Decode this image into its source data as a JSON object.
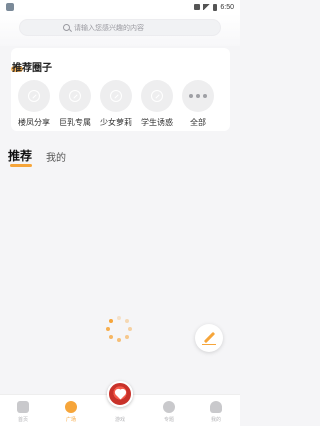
{
  "status_bar": {
    "time": "6:50"
  },
  "search": {
    "placeholder": "请输入您感兴趣的内容"
  },
  "recommended_circles": {
    "title": "推荐圈子",
    "items": [
      {
        "label": "楼凤分享",
        "icon": "image-placeholder-icon"
      },
      {
        "label": "巨乳专属",
        "icon": "image-placeholder-icon"
      },
      {
        "label": "少女萝莉",
        "icon": "image-placeholder-icon"
      },
      {
        "label": "学生诱惑",
        "icon": "image-placeholder-icon"
      },
      {
        "label": "全部",
        "icon": "more-dots-icon"
      }
    ]
  },
  "tabs": {
    "active": "推荐",
    "items": [
      "推荐",
      "我的"
    ]
  },
  "bottom_nav": {
    "items": [
      {
        "label": "首页",
        "active": false
      },
      {
        "label": "广场",
        "active": true
      },
      {
        "label": "游戏",
        "active": false
      },
      {
        "label": "专题",
        "active": false
      },
      {
        "label": "我的",
        "active": false
      }
    ]
  },
  "colors": {
    "accent": "#f6a53a",
    "background": "#f5f5f7",
    "card": "#ffffff"
  }
}
